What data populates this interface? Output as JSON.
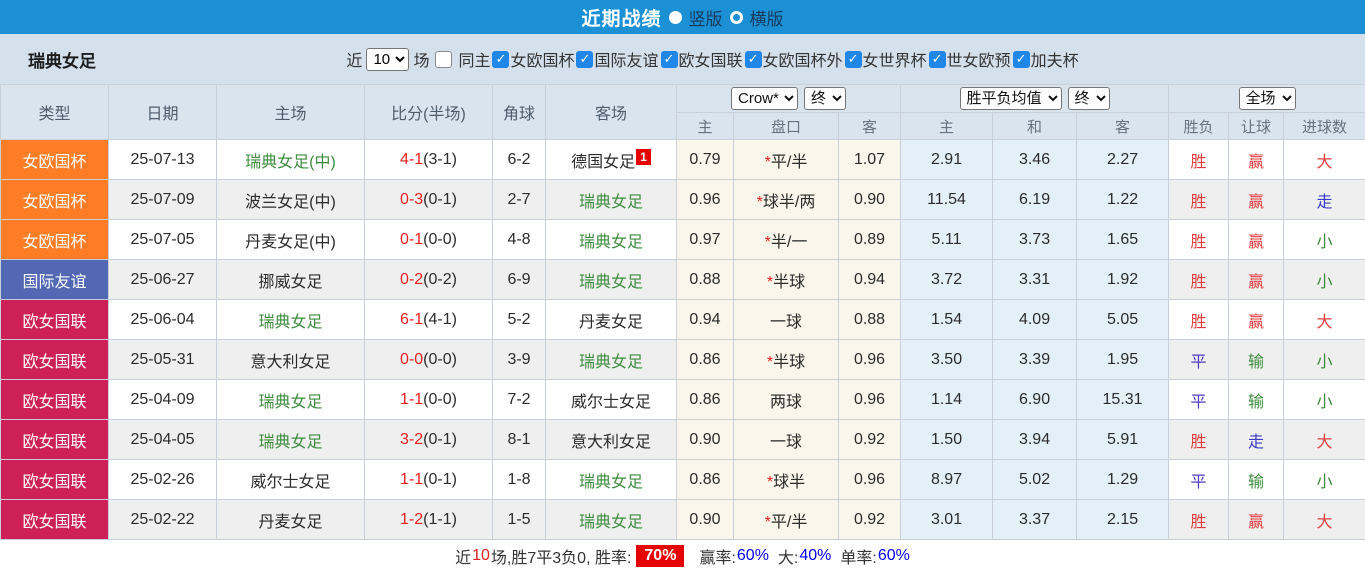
{
  "topbar": {
    "title": "近期战绩",
    "radio_vertical_label": "竖版",
    "radio_horizontal_label": "横版",
    "selected": "竖版"
  },
  "filter": {
    "team": "瑞典女足",
    "near_label": "近",
    "count_value": "10",
    "games_label": "场",
    "same_home_label": "同主",
    "leagues": [
      "女欧国杯",
      "国际友谊",
      "欧女国联",
      "女欧国杯外",
      "女世界杯",
      "世女欧预",
      "加夫杯"
    ]
  },
  "table": {
    "columns": [
      "类型",
      "日期",
      "主场",
      "比分(半场)",
      "角球",
      "客场"
    ],
    "subcolumns": [
      "主",
      "盘口",
      "客",
      "主",
      "和",
      "客",
      "胜负",
      "让球",
      "进球数"
    ],
    "selects": {
      "odds_source": "Crow*",
      "odds_state": "终",
      "avg_label": "胜平负均值",
      "avg_state": "终",
      "scope": "全场"
    },
    "rows": [
      {
        "type": "女欧国杯",
        "type_color": "orange",
        "date": "25-07-13",
        "home": "瑞典女足(中)",
        "home_green": true,
        "score_ft": "4-1",
        "score_ht": "3-1",
        "corners": "6-2",
        "away": "德国女足",
        "away_green": false,
        "away_badge": "1",
        "crow_home": "0.79",
        "handicap": "*平/半",
        "crow_away": "1.07",
        "avg_home": "2.91",
        "avg_draw": "3.46",
        "avg_away": "2.27",
        "wdl": "胜",
        "let": "赢",
        "goals": "大"
      },
      {
        "type": "女欧国杯",
        "type_color": "orange",
        "date": "25-07-09",
        "home": "波兰女足(中)",
        "home_green": false,
        "score_ft": "0-3",
        "score_ht": "0-1",
        "corners": "2-7",
        "away": "瑞典女足",
        "away_green": true,
        "away_badge": "",
        "crow_home": "0.96",
        "handicap": "*球半/两",
        "crow_away": "0.90",
        "avg_home": "11.54",
        "avg_draw": "6.19",
        "avg_away": "1.22",
        "wdl": "胜",
        "let": "赢",
        "goals": "走"
      },
      {
        "type": "女欧国杯",
        "type_color": "orange",
        "date": "25-07-05",
        "home": "丹麦女足(中)",
        "home_green": false,
        "score_ft": "0-1",
        "score_ht": "0-0",
        "corners": "4-8",
        "away": "瑞典女足",
        "away_green": true,
        "away_badge": "",
        "crow_home": "0.97",
        "handicap": "*半/一",
        "crow_away": "0.89",
        "avg_home": "5.11",
        "avg_draw": "3.73",
        "avg_away": "1.65",
        "wdl": "胜",
        "let": "赢",
        "goals": "小"
      },
      {
        "type": "国际友谊",
        "type_color": "blue",
        "date": "25-06-27",
        "home": "挪威女足",
        "home_green": false,
        "score_ft": "0-2",
        "score_ht": "0-2",
        "corners": "6-9",
        "away": "瑞典女足",
        "away_green": true,
        "away_badge": "",
        "crow_home": "0.88",
        "handicap": "*半球",
        "crow_away": "0.94",
        "avg_home": "3.72",
        "avg_draw": "3.31",
        "avg_away": "1.92",
        "wdl": "胜",
        "let": "赢",
        "goals": "小"
      },
      {
        "type": "欧女国联",
        "type_color": "crimson",
        "date": "25-06-04",
        "home": "瑞典女足",
        "home_green": true,
        "score_ft": "6-1",
        "score_ht": "4-1",
        "corners": "5-2",
        "away": "丹麦女足",
        "away_green": false,
        "away_badge": "",
        "crow_home": "0.94",
        "handicap": "一球",
        "crow_away": "0.88",
        "avg_home": "1.54",
        "avg_draw": "4.09",
        "avg_away": "5.05",
        "wdl": "胜",
        "let": "赢",
        "goals": "大"
      },
      {
        "type": "欧女国联",
        "type_color": "crimson",
        "date": "25-05-31",
        "home": "意大利女足",
        "home_green": false,
        "score_ft": "0-0",
        "score_ht": "0-0",
        "corners": "3-9",
        "away": "瑞典女足",
        "away_green": true,
        "away_badge": "",
        "crow_home": "0.86",
        "handicap": "*半球",
        "crow_away": "0.96",
        "avg_home": "3.50",
        "avg_draw": "3.39",
        "avg_away": "1.95",
        "wdl": "平",
        "let": "输",
        "goals": "小"
      },
      {
        "type": "欧女国联",
        "type_color": "crimson",
        "date": "25-04-09",
        "home": "瑞典女足",
        "home_green": true,
        "score_ft": "1-1",
        "score_ht": "0-0",
        "corners": "7-2",
        "away": "威尔士女足",
        "away_green": false,
        "away_badge": "",
        "crow_home": "0.86",
        "handicap": "两球",
        "crow_away": "0.96",
        "avg_home": "1.14",
        "avg_draw": "6.90",
        "avg_away": "15.31",
        "wdl": "平",
        "let": "输",
        "goals": "小"
      },
      {
        "type": "欧女国联",
        "type_color": "crimson",
        "date": "25-04-05",
        "home": "瑞典女足",
        "home_green": true,
        "score_ft": "3-2",
        "score_ht": "0-1",
        "corners": "8-1",
        "away": "意大利女足",
        "away_green": false,
        "away_badge": "",
        "crow_home": "0.90",
        "handicap": "一球",
        "crow_away": "0.92",
        "avg_home": "1.50",
        "avg_draw": "3.94",
        "avg_away": "5.91",
        "wdl": "胜",
        "let": "走",
        "goals": "大"
      },
      {
        "type": "欧女国联",
        "type_color": "crimson",
        "date": "25-02-26",
        "home": "威尔士女足",
        "home_green": false,
        "score_ft": "1-1",
        "score_ht": "0-1",
        "corners": "1-8",
        "away": "瑞典女足",
        "away_green": true,
        "away_badge": "",
        "crow_home": "0.86",
        "handicap": "*球半",
        "crow_away": "0.96",
        "avg_home": "8.97",
        "avg_draw": "5.02",
        "avg_away": "1.29",
        "wdl": "平",
        "let": "输",
        "goals": "小"
      },
      {
        "type": "欧女国联",
        "type_color": "crimson",
        "date": "25-02-22",
        "home": "丹麦女足",
        "home_green": false,
        "score_ft": "1-2",
        "score_ht": "1-1",
        "corners": "1-5",
        "away": "瑞典女足",
        "away_green": true,
        "away_badge": "",
        "crow_home": "0.90",
        "handicap": "*平/半",
        "crow_away": "0.92",
        "avg_home": "3.01",
        "avg_draw": "3.37",
        "avg_away": "2.15",
        "wdl": "胜",
        "let": "赢",
        "goals": "大"
      }
    ]
  },
  "footer": {
    "prefix": "近",
    "count": "10",
    "middle": "场,胜7平3负0, 胜率:",
    "win_rate": "70%",
    "win_odds_label": "赢率:",
    "win_odds_value": "60%",
    "big_label": "大:",
    "big_value": "40%",
    "single_label": "单率:",
    "single_value": "60%"
  },
  "colors": {
    "accent_blue": "#1B90D5",
    "checkbox_blue": "#2086E8",
    "team_green": "#3E8C3E",
    "score_red": "#E51F1F",
    "footer_value_blue": "#0000EE",
    "badge_red": "#E60000",
    "type": {
      "orange": "#FF7D26",
      "blue": "#5268B4",
      "crimson": "#CE2058"
    },
    "result": {
      "胜": "#E03E3E",
      "平": "#4F3BC4",
      "赢": "#E03E3E",
      "输": "#3E8C3E",
      "走": "#3A3AC8",
      "大": "#E03E3E",
      "小": "#3E8C3E"
    }
  }
}
